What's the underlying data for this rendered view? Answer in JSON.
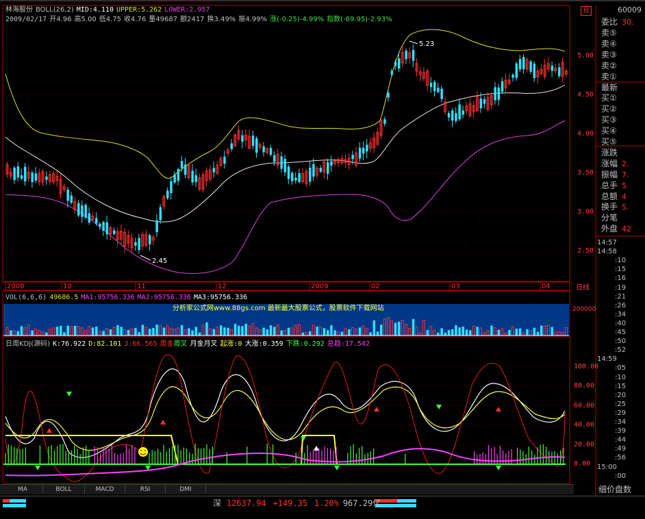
{
  "stock": {
    "name": "林海股份",
    "code": "60009"
  },
  "boll_line": {
    "name": "BOLL",
    "params": "(26,2)",
    "mid": "MID:4.110",
    "upper": "UPPER:5.262",
    "lower": "LOWER:2.957"
  },
  "quote_line": {
    "date": "2009/02/17",
    "open": "开4.96",
    "high": "高5.00",
    "low": "低4.75",
    "close": "收4.76",
    "vol": "量49687",
    "amount": "额2417",
    "turnover": "换3.49%",
    "amplitude": "振4.99%",
    "change": "涨(-0.25)-4.99%",
    "index": "指数(-69.95)-2.93%"
  },
  "price_axis": [
    "5.00",
    "4.50",
    "4.00",
    "3.50",
    "3.00",
    "2.50"
  ],
  "price_labels": {
    "high": "5.23",
    "low": "2.45"
  },
  "date_axis": [
    "2008",
    "10",
    "11",
    "12",
    "2009",
    "02",
    "03",
    "04"
  ],
  "date_axis_right": "日线",
  "vol_line": {
    "name": "VOL(6,6,6)",
    "vol": "49686.5",
    "ma1": "MA1:95756.336",
    "ma2": "MA2:95756.336",
    "ma3": "MA3:95756.336"
  },
  "vol_axis": [
    "200000"
  ],
  "banner": "分析家公式网www.88gs.com 最新最大股票公式，股票软件下载网站",
  "kdj_line": {
    "name": "日周KDJ(源码)",
    "k": "K:76.922",
    "d": "D:82.101",
    "j": "J:66.565",
    "zhoujin": "周金",
    "zhoucha": "周叉",
    "yuejin": "月金",
    "yuecha": "月叉",
    "qizhang": "起涨:0",
    "dazhang": "大涨:0.359",
    "xiadie": "下跌:0.292",
    "zongqu": "总趋:17.542"
  },
  "kdj_axis": [
    "100.00",
    "80.00",
    "60.00",
    "40.00",
    "20.00",
    "0.00"
  ],
  "tabs": [
    "MA",
    "BOLL",
    "MACD",
    "RSI",
    "DMI"
  ],
  "right_panel": {
    "title": "委比",
    "title_val": "30.",
    "rows": [
      {
        "label": "卖⑤",
        "val": ""
      },
      {
        "label": "卖④",
        "val": ""
      },
      {
        "label": "卖③",
        "val": ""
      },
      {
        "label": "卖②",
        "val": ""
      },
      {
        "label": "卖①",
        "val": ""
      },
      {
        "label": "最新",
        "val": ""
      },
      {
        "label": "买①",
        "val": ""
      },
      {
        "label": "买②",
        "val": ""
      },
      {
        "label": "买③",
        "val": ""
      },
      {
        "label": "买④",
        "val": ""
      },
      {
        "label": "买⑤",
        "val": ""
      },
      {
        "label": "涨跌",
        "val": ""
      },
      {
        "label": "涨幅",
        "val": "2."
      },
      {
        "label": "振幅",
        "val": "7."
      },
      {
        "label": "总手",
        "val": "5."
      },
      {
        "label": "总额",
        "val": "4"
      },
      {
        "label": "换手",
        "val": "5."
      },
      {
        "label": "分笔",
        "val": ""
      },
      {
        "label": "外盘",
        "val": "42"
      }
    ],
    "times": [
      "14:57",
      "14:58",
      ":10",
      ":15",
      ":16",
      ":19",
      ":21",
      ":26",
      ":34",
      ":40",
      ":45",
      ":50",
      ":52",
      "14:59",
      ":05",
      ":10",
      ":15",
      ":20",
      ":25",
      ":29",
      ":34",
      ":39",
      ":44",
      ":49",
      ":56",
      "15:00",
      ":00"
    ],
    "bottom_tabs": "细价盘数"
  },
  "status_bar": {
    "market": "深",
    "index": "12637.94",
    "change": "+149.35",
    "pct": "1.20%",
    "amount": "967.29亿"
  },
  "colors": {
    "up": "#ff3030",
    "down": "#30e0ff",
    "upper_band": "#e0e020",
    "mid_band": "#e8e8e8",
    "lower_band": "#e040e0",
    "k_line": "#ffffff",
    "d_line": "#ffff40",
    "j_line": "#e02020",
    "vol_bg": "#003888",
    "green": "#40ff40",
    "magenta": "#ff40ff"
  }
}
